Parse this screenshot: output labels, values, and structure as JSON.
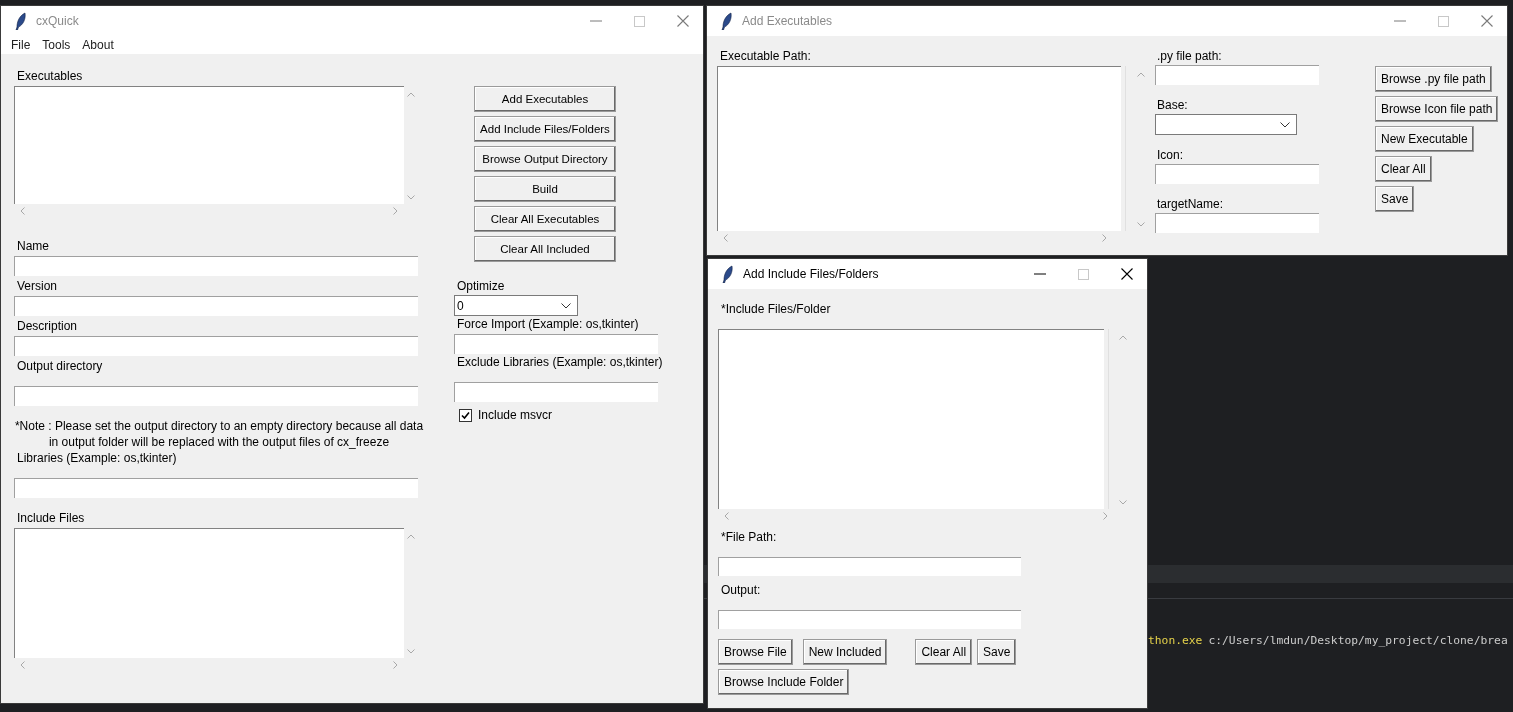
{
  "background_editor": {
    "terminal_line": {
      "command": "thon.exe",
      "path": "c:/Users/lmdun/Desktop/my_project/clone/brea"
    }
  },
  "main_window": {
    "title": "cxQuick",
    "active": false,
    "menu": [
      "File",
      "Tools",
      "About"
    ],
    "executables_list": {
      "label": "Executables"
    },
    "fields": [
      {
        "label": "Name"
      },
      {
        "label": "Version"
      },
      {
        "label": "Description"
      },
      {
        "label": "Output directory"
      }
    ],
    "note_lines": [
      "*Note : Please set the output directory to an empty directory because all data",
      "in output folder will be replaced with the output files of cx_freeze"
    ],
    "libraries_field": {
      "label": "Libraries (Example: os,tkinter)"
    },
    "include_files_list": {
      "label": "Include Files"
    },
    "buttons": [
      "Add Executables",
      "Add Include Files/Folders",
      "Browse Output Directory",
      "Build",
      "Clear All Executables",
      "Clear All Included"
    ],
    "optimize": {
      "label": "Optimize",
      "value": "0"
    },
    "force_import": {
      "label": "Force Import (Example: os,tkinter)"
    },
    "exclude_libraries": {
      "label": "Exclude Libraries (Example: os,tkinter)"
    },
    "include_msvcr": {
      "label": "Include msvcr",
      "checked": true
    }
  },
  "add_executables_window": {
    "title": "Add Executables",
    "active": false,
    "list_label": "Executable Path:",
    "fields": [
      {
        "label": ".py file path:",
        "kind": "entry"
      },
      {
        "label": "Base:",
        "kind": "combo"
      },
      {
        "label": "Icon:",
        "kind": "entry"
      },
      {
        "label": "targetName:",
        "kind": "entry"
      }
    ],
    "buttons": [
      "Browse .py file path",
      "Browse Icon file path",
      "New Executable",
      "Clear All",
      "Save"
    ]
  },
  "include_window": {
    "title": "Add Include Files/Folders",
    "active": true,
    "list_label": "*Include Files/Folder",
    "fields": [
      {
        "label": "*File Path:"
      },
      {
        "label": "Output:"
      }
    ],
    "button_rows": [
      [
        "Browse File",
        "New Included",
        "Clear All",
        "Save"
      ],
      [
        "Browse Include Folder"
      ]
    ]
  }
}
